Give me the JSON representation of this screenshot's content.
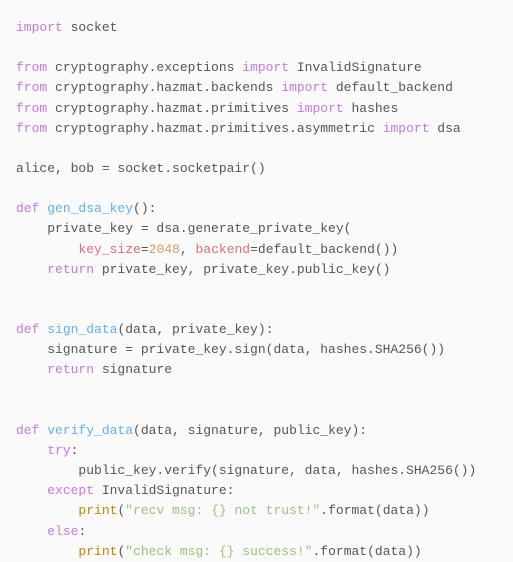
{
  "lines": [
    {
      "segments": [
        {
          "cls": "kw",
          "t": "import"
        },
        {
          "cls": "txt",
          "t": " socket"
        }
      ]
    },
    {
      "segments": []
    },
    {
      "segments": [
        {
          "cls": "kw",
          "t": "from"
        },
        {
          "cls": "txt",
          "t": " cryptography.exceptions "
        },
        {
          "cls": "kw",
          "t": "import"
        },
        {
          "cls": "txt",
          "t": " InvalidSignature"
        }
      ]
    },
    {
      "segments": [
        {
          "cls": "kw",
          "t": "from"
        },
        {
          "cls": "txt",
          "t": " cryptography.hazmat.backends "
        },
        {
          "cls": "kw",
          "t": "import"
        },
        {
          "cls": "txt",
          "t": " default_backend"
        }
      ]
    },
    {
      "segments": [
        {
          "cls": "kw",
          "t": "from"
        },
        {
          "cls": "txt",
          "t": " cryptography.hazmat.primitives "
        },
        {
          "cls": "kw",
          "t": "import"
        },
        {
          "cls": "txt",
          "t": " hashes"
        }
      ]
    },
    {
      "segments": [
        {
          "cls": "kw",
          "t": "from"
        },
        {
          "cls": "txt",
          "t": " cryptography.hazmat.primitives.asymmetric "
        },
        {
          "cls": "kw",
          "t": "import"
        },
        {
          "cls": "txt",
          "t": " dsa"
        }
      ]
    },
    {
      "segments": []
    },
    {
      "segments": [
        {
          "cls": "txt",
          "t": "alice, bob = socket.socketpair()"
        }
      ]
    },
    {
      "segments": []
    },
    {
      "segments": [
        {
          "cls": "kw",
          "t": "def "
        },
        {
          "cls": "fn",
          "t": "gen_dsa_key"
        },
        {
          "cls": "txt",
          "t": "():"
        }
      ]
    },
    {
      "segments": [
        {
          "cls": "txt",
          "t": "    private_key = dsa.generate_private_key("
        }
      ]
    },
    {
      "segments": [
        {
          "cls": "txt",
          "t": "        "
        },
        {
          "cls": "param",
          "t": "key_size"
        },
        {
          "cls": "txt",
          "t": "="
        },
        {
          "cls": "num",
          "t": "2048"
        },
        {
          "cls": "txt",
          "t": ", "
        },
        {
          "cls": "param",
          "t": "backend"
        },
        {
          "cls": "txt",
          "t": "=default_backend())"
        }
      ]
    },
    {
      "segments": [
        {
          "cls": "txt",
          "t": "    "
        },
        {
          "cls": "kw",
          "t": "return"
        },
        {
          "cls": "txt",
          "t": " private_key, private_key.public_key()"
        }
      ]
    },
    {
      "segments": []
    },
    {
      "segments": []
    },
    {
      "segments": [
        {
          "cls": "kw",
          "t": "def "
        },
        {
          "cls": "fn",
          "t": "sign_data"
        },
        {
          "cls": "txt",
          "t": "(data, private_key):"
        }
      ]
    },
    {
      "segments": [
        {
          "cls": "txt",
          "t": "    signature = private_key.sign(data, hashes.SHA256())"
        }
      ]
    },
    {
      "segments": [
        {
          "cls": "txt",
          "t": "    "
        },
        {
          "cls": "kw",
          "t": "return"
        },
        {
          "cls": "txt",
          "t": " signature"
        }
      ]
    },
    {
      "segments": []
    },
    {
      "segments": []
    },
    {
      "segments": [
        {
          "cls": "kw",
          "t": "def "
        },
        {
          "cls": "fn",
          "t": "verify_data"
        },
        {
          "cls": "txt",
          "t": "(data, signature, public_key):"
        }
      ]
    },
    {
      "segments": [
        {
          "cls": "txt",
          "t": "    "
        },
        {
          "cls": "kw",
          "t": "try"
        },
        {
          "cls": "txt",
          "t": ":"
        }
      ]
    },
    {
      "segments": [
        {
          "cls": "txt",
          "t": "        public_key.verify(signature, data, hashes.SHA256())"
        }
      ]
    },
    {
      "segments": [
        {
          "cls": "txt",
          "t": "    "
        },
        {
          "cls": "kw",
          "t": "except"
        },
        {
          "cls": "txt",
          "t": " InvalidSignature:"
        }
      ]
    },
    {
      "segments": [
        {
          "cls": "txt",
          "t": "        "
        },
        {
          "cls": "builtin",
          "t": "print"
        },
        {
          "cls": "txt",
          "t": "("
        },
        {
          "cls": "str",
          "t": "\"recv msg: {} not trust!\""
        },
        {
          "cls": "txt",
          "t": ".format(data))"
        }
      ]
    },
    {
      "segments": [
        {
          "cls": "txt",
          "t": "    "
        },
        {
          "cls": "kw",
          "t": "else"
        },
        {
          "cls": "txt",
          "t": ":"
        }
      ]
    },
    {
      "segments": [
        {
          "cls": "txt",
          "t": "        "
        },
        {
          "cls": "builtin",
          "t": "print"
        },
        {
          "cls": "txt",
          "t": "("
        },
        {
          "cls": "str",
          "t": "\"check msg: {} success!\""
        },
        {
          "cls": "txt",
          "t": ".format(data))"
        }
      ]
    }
  ]
}
